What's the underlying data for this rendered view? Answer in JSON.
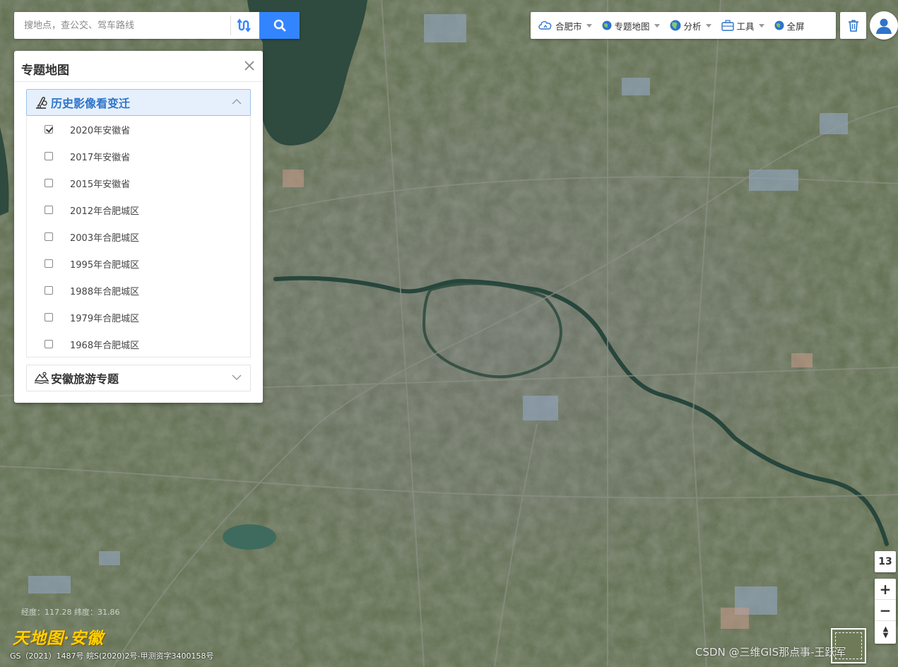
{
  "search": {
    "placeholder": "搜地点，查公交、驾车路线"
  },
  "toolbar": {
    "city": "合肥市",
    "theme_map": "专题地图",
    "analysis": "分析",
    "tools": "工具",
    "fullscreen": "全屏"
  },
  "panel": {
    "title": "专题地图",
    "groups": [
      {
        "label": "历史影像看变迁",
        "expanded": true,
        "layers": [
          {
            "label": "2020年安徽省",
            "checked": true
          },
          {
            "label": "2017年安徽省",
            "checked": false
          },
          {
            "label": "2015年安徽省",
            "checked": false
          },
          {
            "label": "2012年合肥城区",
            "checked": false
          },
          {
            "label": "2003年合肥城区",
            "checked": false
          },
          {
            "label": "1995年合肥城区",
            "checked": false
          },
          {
            "label": "1988年合肥城区",
            "checked": false
          },
          {
            "label": "1979年合肥城区",
            "checked": false
          },
          {
            "label": "1968年合肥城区",
            "checked": false
          }
        ]
      },
      {
        "label": "安徽旅游专题",
        "expanded": false
      }
    ]
  },
  "map": {
    "zoom_level": "13",
    "zoom_in": "+",
    "zoom_out": "−",
    "compass": "▲▼",
    "coordinates": "经度：117.28 纬度：31.86",
    "logo_text": "天地图·安徽",
    "copyright": "GS（2021）1487号 皖S(2020)2号-甲测资字3400158号",
    "watermark": "CSDN @三维GIS那点事-王跃军"
  },
  "colors": {
    "accent": "#3385ff",
    "group_active_text": "#2e74c9",
    "group_active_bg": "#e6f0fc",
    "logo": "#ffd200"
  },
  "icons": [
    "route-switch-icon",
    "search-icon",
    "cloud-icon",
    "globe-icon",
    "toolbox-icon",
    "trash-icon",
    "user-icon",
    "close-icon",
    "history-icon",
    "travel-icon",
    "chevron-up-icon",
    "chevron-down-icon"
  ]
}
